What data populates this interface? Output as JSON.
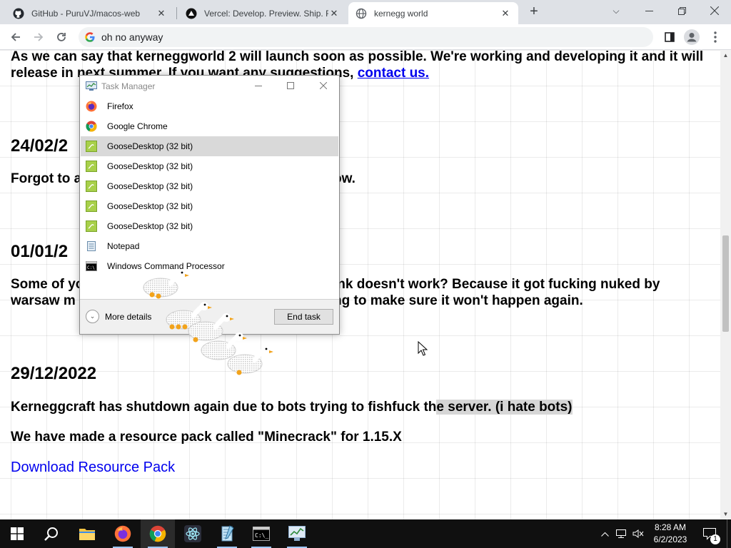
{
  "browser": {
    "tabs": [
      {
        "title": "GitHub - PuruVJ/macos-web",
        "icon": "github-icon"
      },
      {
        "title": "Vercel: Develop. Preview. Ship. Fo",
        "icon": "vercel-icon"
      },
      {
        "title": "kernegg world",
        "icon": "globe-icon"
      }
    ],
    "address": "oh no anyway"
  },
  "page": {
    "intro_text": "As we can say that kerneggworld 2 will launch soon as possible. We're working and developing it and it will release in next summer. If you want any suggestions, ",
    "intro_link": "contact us.",
    "date1": "24/02/2",
    "text1_left": "Forgot to a",
    "text1_right": "ow.",
    "date2": "01/01/2",
    "text2_line1_left": "Some of yo",
    "text2_line1_right": "ink doesn't work? Because it got fucking nuked by",
    "text2_line2_left": "warsaw m",
    "text2_line2_right": "ng to make sure it won't happen again.",
    "date3": "29/12/2022",
    "text3_part1": "Kerneggcraft has shutdown again due to bots trying to fishfuck th",
    "text3_selected": "e server. (i hate bots)",
    "text4": "We have made a resource pack called \"Minecrack\" for 1.15.X",
    "download_link": "Download Resource Pack"
  },
  "task_manager": {
    "title": "Task Manager",
    "processes": [
      {
        "name": "Firefox",
        "icon": "firefox-icon",
        "selected": false
      },
      {
        "name": "Google Chrome",
        "icon": "chrome-icon",
        "selected": false
      },
      {
        "name": "GooseDesktop (32 bit)",
        "icon": "goose-icon",
        "selected": true
      },
      {
        "name": "GooseDesktop (32 bit)",
        "icon": "goose-icon",
        "selected": false
      },
      {
        "name": "GooseDesktop (32 bit)",
        "icon": "goose-icon",
        "selected": false
      },
      {
        "name": "GooseDesktop (32 bit)",
        "icon": "goose-icon",
        "selected": false
      },
      {
        "name": "GooseDesktop (32 bit)",
        "icon": "goose-icon",
        "selected": false
      },
      {
        "name": "Notepad",
        "icon": "notepad-icon",
        "selected": false
      },
      {
        "name": "Windows Command Processor",
        "icon": "cmd-icon",
        "selected": false
      }
    ],
    "more_details": "More details",
    "end_task": "End task"
  },
  "taskbar": {
    "time": "8:28 AM",
    "date": "6/2/2023",
    "notification_count": "1",
    "pinned": [
      "windows-start",
      "search",
      "file-explorer",
      "firefox",
      "chrome",
      "electron-app",
      "notepad",
      "terminal",
      "task-manager"
    ]
  },
  "colors": {
    "tabstrip": "#dee1e6",
    "link": "#0000ee",
    "selection": "#d6d6d6",
    "taskbar": "#101010",
    "goose_icon": "#a8d04a"
  }
}
